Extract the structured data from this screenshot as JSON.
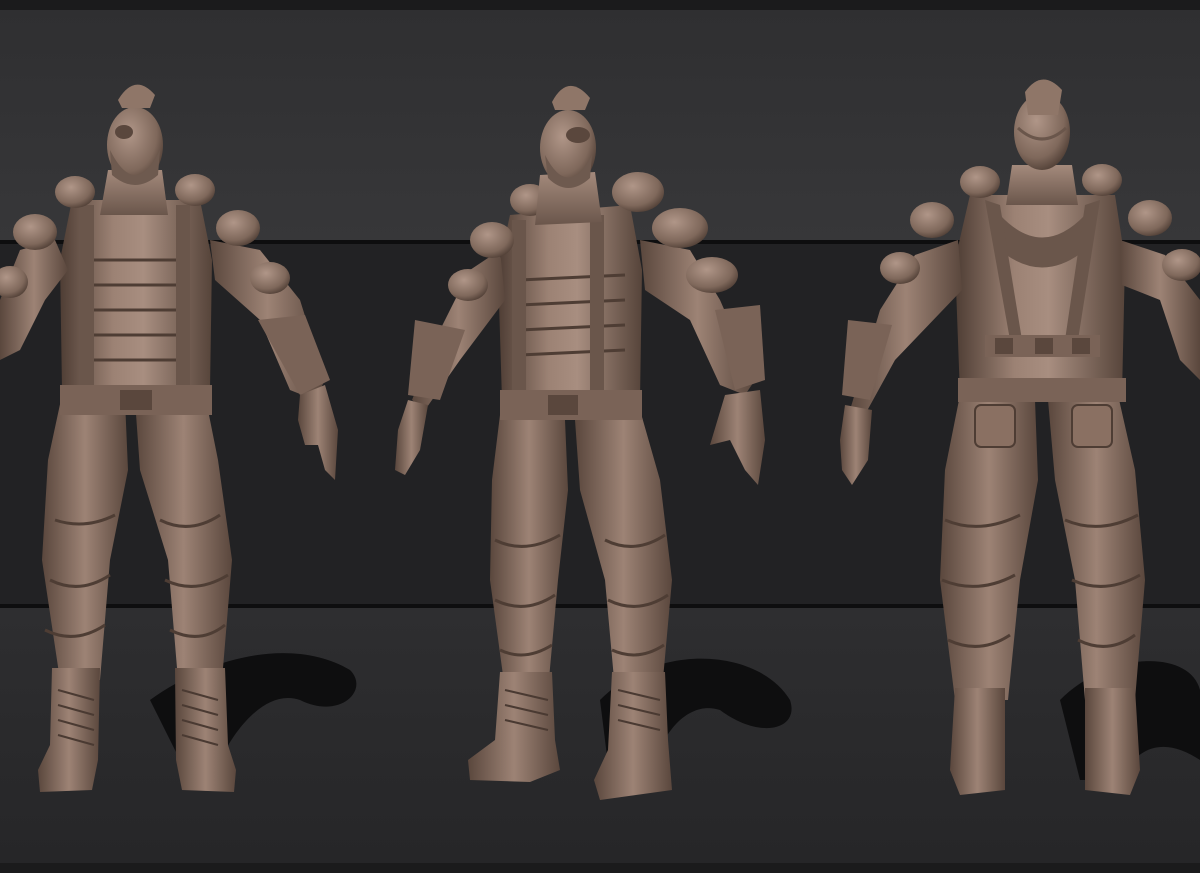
{
  "scene": {
    "description_hidden": "",
    "background_top_color": "#333335",
    "background_band_color": "#222224",
    "background_floor_color": "#2b2b2d",
    "divider_line_color": "#0e0e0f",
    "border_color": "#1b1b1c",
    "clay_light_color": "#a88e80",
    "clay_mid_color": "#7a6357",
    "clay_dark_color": "#4a3a32",
    "shadow_color": "#0b0b0c"
  },
  "figures": [
    {
      "id": "front",
      "view": "front-view"
    },
    {
      "id": "three-quarter",
      "view": "three-quarter-view"
    },
    {
      "id": "back",
      "view": "back-view"
    }
  ]
}
